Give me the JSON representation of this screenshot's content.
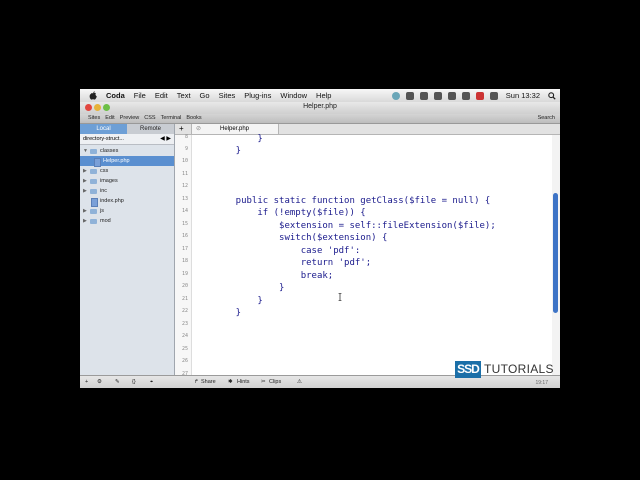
{
  "menubar": {
    "app_name": "Coda",
    "menus": [
      "File",
      "Edit",
      "Text",
      "Go",
      "Sites",
      "Plug-ins",
      "Window",
      "Help"
    ],
    "clock": "Sun 13:32"
  },
  "window": {
    "title": "Helper.php"
  },
  "toolbar": {
    "tabs": [
      "Sites",
      "Edit",
      "Preview",
      "CSS",
      "Terminal",
      "Books"
    ],
    "search_label": "Search"
  },
  "sidebar": {
    "segments": {
      "local": "Local",
      "remote": "Remote"
    },
    "path": "directory-struct...",
    "tree": [
      {
        "label": "classes",
        "type": "folder",
        "expanded": true,
        "depth": 0
      },
      {
        "label": "Helper.php",
        "type": "php",
        "depth": 1,
        "selected": true
      },
      {
        "label": "css",
        "type": "folder",
        "depth": 0
      },
      {
        "label": "images",
        "type": "folder",
        "depth": 0
      },
      {
        "label": "inc",
        "type": "folder",
        "depth": 0
      },
      {
        "label": "index.php",
        "type": "php",
        "depth": 0
      },
      {
        "label": "js",
        "type": "folder",
        "depth": 0
      },
      {
        "label": "mod",
        "type": "folder",
        "depth": 0
      }
    ]
  },
  "editor": {
    "tab_name": "Helper.php",
    "line_numbers": [
      "8",
      "9",
      "10",
      "11",
      "12",
      "13",
      "14",
      "15",
      "16",
      "17",
      "18",
      "19",
      "20",
      "21",
      "22",
      "23",
      "24",
      "25",
      "26",
      "27"
    ],
    "code": [
      {
        "line": 9,
        "text": "        }"
      },
      {
        "line": 10,
        "text": "    }"
      },
      {
        "line": 14,
        "text": "    public static function getClass($file = null) {"
      },
      {
        "line": 15,
        "text": "        if (!empty($file)) {"
      },
      {
        "line": 16,
        "text": "            $extension = self::fileExtension($file);"
      },
      {
        "line": 17,
        "text": "            switch($extension) {"
      },
      {
        "line": 18,
        "text": "                case 'pdf':"
      },
      {
        "line": 19,
        "text": "                return 'pdf';"
      },
      {
        "line": 20,
        "text": "                break;"
      },
      {
        "line": 21,
        "text": "            }"
      },
      {
        "line": 22,
        "text": "        }"
      },
      {
        "line": 23,
        "text": "    }"
      }
    ]
  },
  "statusbar": {
    "share": "Share",
    "hints": "Hints",
    "clips": "Clips",
    "position": "19:17"
  },
  "logo": {
    "box_text": "SSD",
    "word": "TUTORIALS"
  }
}
